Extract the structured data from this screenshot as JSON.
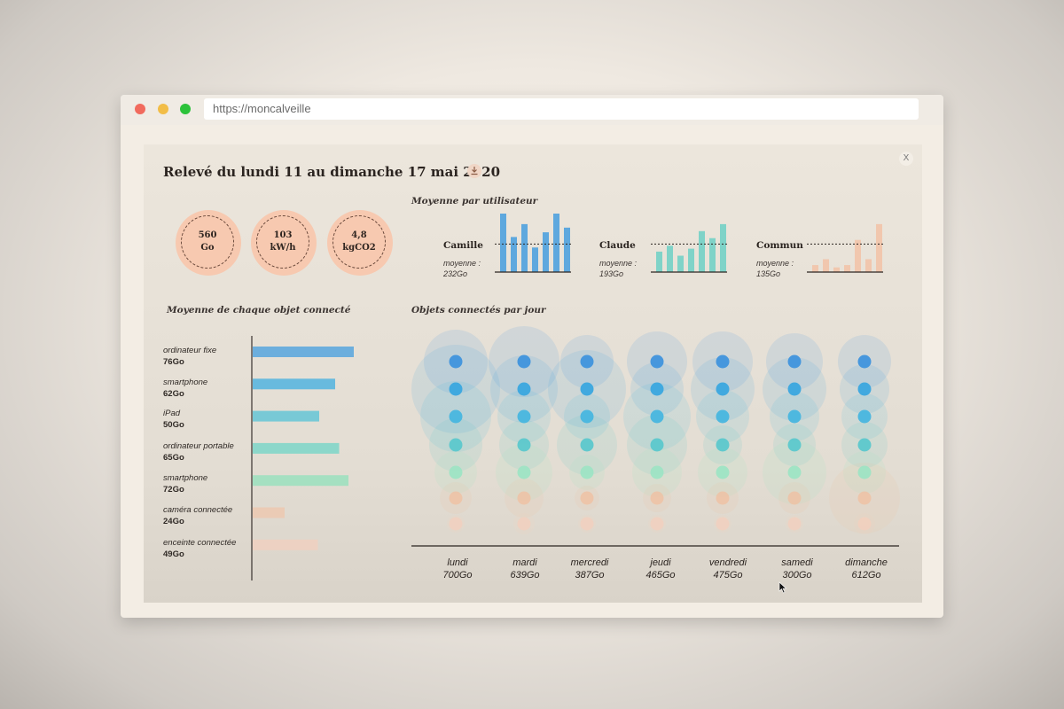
{
  "browser": {
    "url": "https://moncalveille",
    "close_label": "X"
  },
  "report": {
    "title": "Relevé du lundi 11 au dimanche 17 mai 2020",
    "kpis": [
      {
        "value": "560",
        "unit": "Go"
      },
      {
        "value": "103",
        "unit": "kW/h"
      },
      {
        "value": "4,8",
        "unit": "kgCO2"
      }
    ],
    "users_title": "Moyenne par utilisateur",
    "users": [
      {
        "name": "Camille",
        "avg_label": "moyenne :",
        "avg_value": "232Go",
        "color": "#5ea8de",
        "values": [
          100,
          60,
          82,
          42,
          68,
          100,
          76
        ]
      },
      {
        "name": "Claude",
        "avg_label": "moyenne :",
        "avg_value": "193Go",
        "color": "#7fd3c8",
        "values": [
          35,
          45,
          28,
          40,
          70,
          58,
          82
        ]
      },
      {
        "name": "Commun",
        "avg_label": "moyenne :",
        "avg_value": "135Go",
        "color": "#f1c7ae",
        "values": [
          12,
          22,
          8,
          12,
          55,
          22,
          82
        ]
      }
    ],
    "objects_title": "Moyenne de chaque objet connecté",
    "objects": [
      {
        "name": "ordinateur fixe",
        "value": "76Go",
        "amount": 76,
        "color": "#5ea8de"
      },
      {
        "name": "smartphone",
        "value": "62Go",
        "amount": 62,
        "color": "#5ab6df"
      },
      {
        "name": "iPad",
        "value": "50Go",
        "amount": 50,
        "color": "#6bc6d6"
      },
      {
        "name": "ordinateur portable",
        "value": "65Go",
        "amount": 65,
        "color": "#82d6c9"
      },
      {
        "name": "smartphone",
        "value": "72Go",
        "amount": 72,
        "color": "#9fe0bf"
      },
      {
        "name": "caméra connectée",
        "value": "24Go",
        "amount": 24,
        "color": "#efc6ac"
      },
      {
        "name": "enceinte connectée",
        "value": "49Go",
        "amount": 49,
        "color": "#f2cfbe"
      }
    ],
    "days_title": "Objets connectés par jour",
    "days": [
      {
        "name": "lundi",
        "total": "700Go"
      },
      {
        "name": "mardi",
        "total": "639Go"
      },
      {
        "name": "mercredi",
        "total": "387Go"
      },
      {
        "name": "jeudi",
        "total": "465Go"
      },
      {
        "name": "vendredi",
        "total": "475Go"
      },
      {
        "name": "samedi",
        "total": "300Go"
      },
      {
        "name": "dimanche",
        "total": "612Go"
      }
    ],
    "dot_colors": [
      "#3f94dd",
      "#3aa6df",
      "#48b6df",
      "#5cc8cc",
      "#9ee4c4",
      "#f2be9c",
      "#f5cfbc"
    ]
  }
}
